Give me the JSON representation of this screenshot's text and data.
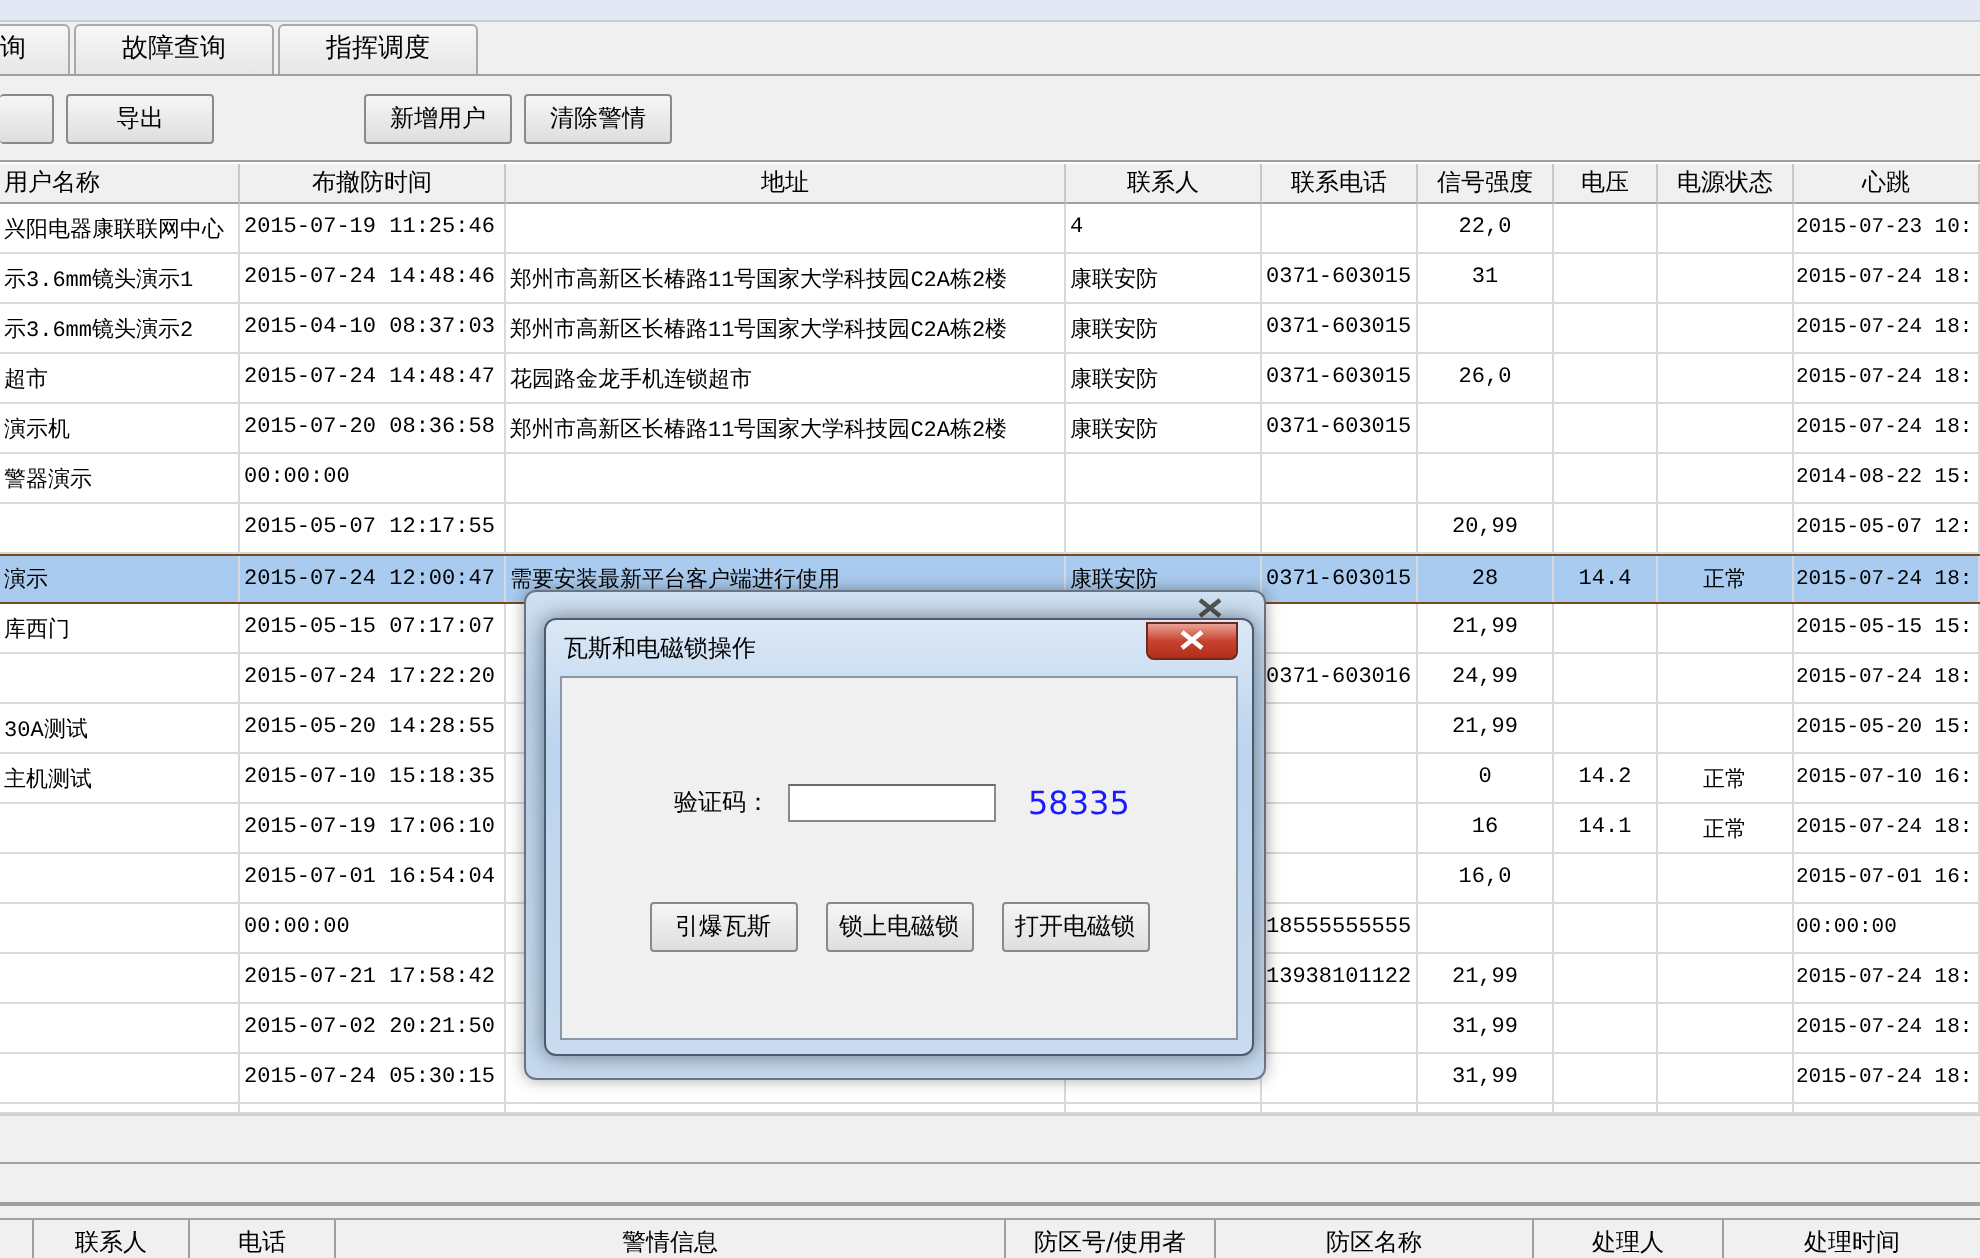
{
  "tabs": [
    {
      "label": "询"
    },
    {
      "label": "故障查询"
    },
    {
      "label": "指挥调度"
    }
  ],
  "toolbar": [
    {
      "kind": "partial"
    },
    {
      "kind": "button",
      "label": "导出"
    },
    {
      "kind": "gap"
    },
    {
      "kind": "button",
      "label": "新增用户"
    },
    {
      "kind": "button",
      "label": "清除警情"
    }
  ],
  "table": {
    "columns": [
      "用户名称",
      "布撤防时间",
      "地址",
      "联系人",
      "联系电话",
      "信号强度",
      "电压",
      "电源状态",
      "心跳"
    ],
    "rows": [
      {
        "selected": false,
        "cells": [
          "兴阳电器康联联网中心",
          "2015-07-19 11:25:46",
          "",
          "4",
          "",
          "22,0",
          "",
          "",
          "2015-07-23 10:"
        ]
      },
      {
        "selected": false,
        "cells": [
          "示3.6mm镜头演示1",
          "2015-07-24 14:48:46",
          "郑州市高新区长椿路11号国家大学科技园C2A栋2楼",
          "康联安防",
          "0371-603015",
          "31",
          "",
          "",
          "2015-07-24 18:"
        ]
      },
      {
        "selected": false,
        "cells": [
          "示3.6mm镜头演示2",
          "2015-04-10 08:37:03",
          "郑州市高新区长椿路11号国家大学科技园C2A栋2楼",
          "康联安防",
          "0371-603015",
          "",
          "",
          "",
          "2015-07-24 18:"
        ]
      },
      {
        "selected": false,
        "cells": [
          "超市",
          "2015-07-24 14:48:47",
          "花园路金龙手机连锁超市",
          "康联安防",
          "0371-603015",
          "26,0",
          "",
          "",
          "2015-07-24 18:"
        ]
      },
      {
        "selected": false,
        "cells": [
          "演示机",
          "2015-07-20 08:36:58",
          "郑州市高新区长椿路11号国家大学科技园C2A栋2楼",
          "康联安防",
          "0371-603015",
          "",
          "",
          "",
          "2015-07-24 18:"
        ]
      },
      {
        "selected": false,
        "cells": [
          "警器演示",
          "00:00:00",
          "",
          "",
          "",
          "",
          "",
          "",
          "2014-08-22 15:"
        ]
      },
      {
        "selected": false,
        "cells": [
          "",
          "2015-05-07 12:17:55",
          "",
          "",
          "",
          "20,99",
          "",
          "",
          "2015-05-07 12:"
        ]
      },
      {
        "selected": true,
        "cells": [
          "演示",
          "2015-07-24 12:00:47",
          "需要安装最新平台客户端进行使用",
          "康联安防",
          "0371-603015",
          "28",
          "14.4",
          "正常",
          "2015-07-24 18:"
        ]
      },
      {
        "selected": false,
        "cells": [
          "库西门",
          "2015-05-15 07:17:07",
          "",
          "",
          "",
          "21,99",
          "",
          "",
          "2015-05-15 15:"
        ]
      },
      {
        "selected": false,
        "cells": [
          "",
          "2015-07-24 17:22:20",
          "",
          "",
          "0371-603016",
          "24,99",
          "",
          "",
          "2015-07-24 18:"
        ]
      },
      {
        "selected": false,
        "cells": [
          "30A测试",
          "2015-05-20 14:28:55",
          "",
          "",
          "",
          "21,99",
          "",
          "",
          "2015-05-20 15:"
        ]
      },
      {
        "selected": false,
        "cells": [
          "主机测试",
          "2015-07-10 15:18:35",
          "",
          "",
          "",
          "0",
          "14.2",
          "正常",
          "2015-07-10 16:"
        ]
      },
      {
        "selected": false,
        "cells": [
          "",
          "2015-07-19 17:06:10",
          "",
          "",
          "",
          "16",
          "14.1",
          "正常",
          "2015-07-24 18:"
        ]
      },
      {
        "selected": false,
        "cells": [
          "",
          "2015-07-01 16:54:04",
          "",
          "",
          "",
          "16,0",
          "",
          "",
          "2015-07-01 16:"
        ]
      },
      {
        "selected": false,
        "cells": [
          "",
          "00:00:00",
          "",
          "",
          "18555555555",
          "",
          "",
          "",
          "00:00:00"
        ]
      },
      {
        "selected": false,
        "cells": [
          "",
          "2015-07-21 17:58:42",
          "",
          "",
          "13938101122",
          "21,99",
          "",
          "",
          "2015-07-24 18:"
        ]
      },
      {
        "selected": false,
        "cells": [
          "",
          "2015-07-02 20:21:50",
          "",
          "",
          "",
          "31,99",
          "",
          "",
          "2015-07-24 18:"
        ]
      },
      {
        "selected": false,
        "cells": [
          "",
          "2015-07-24 05:30:15",
          "",
          "",
          "",
          "31,99",
          "",
          "",
          "2015-07-24 18:"
        ]
      }
    ]
  },
  "alarm_table": {
    "columns": [
      "联系人",
      "电话",
      "警情信息",
      "防区号/使用者",
      "防区名称",
      "处理人",
      "处理时间"
    ]
  },
  "dialog": {
    "title": "瓦斯和电磁锁操作",
    "field_label": "验证码：",
    "code": "58335",
    "buttons": [
      "引爆瓦斯",
      "锁上电磁锁",
      "打开电磁锁"
    ]
  }
}
